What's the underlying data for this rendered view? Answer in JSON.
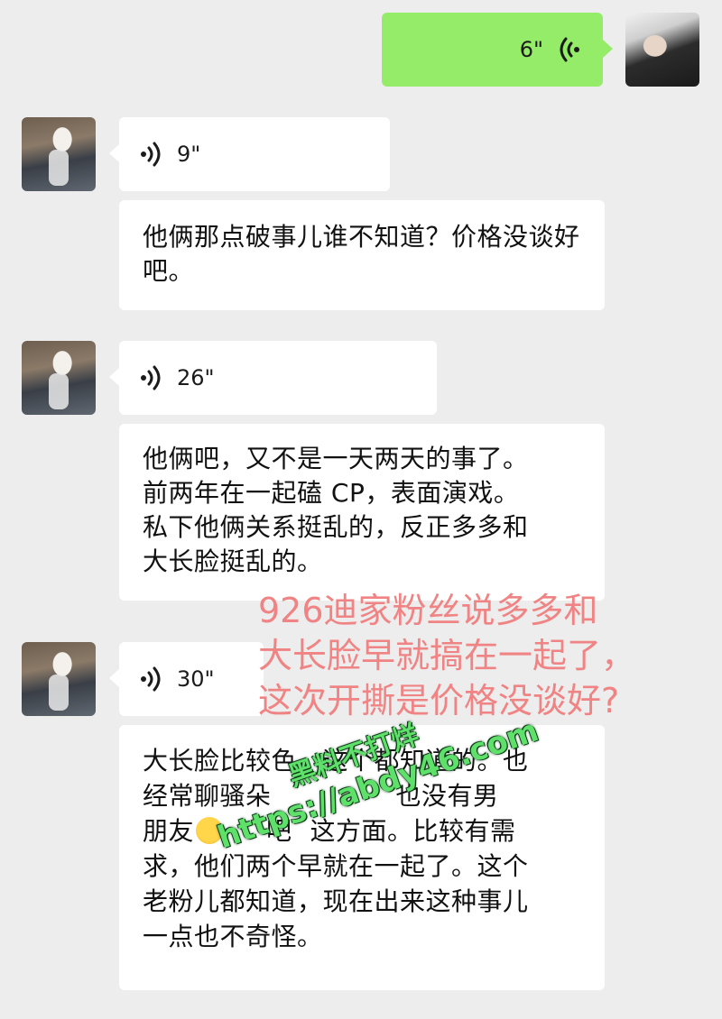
{
  "messages": [
    {
      "sender": "me",
      "type": "voice",
      "duration": "6\""
    },
    {
      "sender": "other",
      "type": "voice",
      "duration": "9\""
    },
    {
      "sender": "other",
      "type": "text",
      "text": "他俩那点破事儿谁不知道？价格没谈好吧。"
    },
    {
      "sender": "other",
      "type": "voice",
      "duration": "26\""
    },
    {
      "sender": "other",
      "type": "text",
      "lines": [
        "他俩吧，又不是一天两天的事了。",
        "前两年在一起磕 CP，表面演戏。",
        "私下他俩关系挺乱的，反正多多和",
        "大长脸挺乱的。"
      ]
    },
    {
      "sender": "other",
      "type": "voice",
      "duration": "30\""
    },
    {
      "sender": "other",
      "type": "text",
      "lines": [
        "大长脸比较色，这个都知道的。也",
        "经常聊骚朵",
        "也没有男",
        "朋友",
        "吧",
        "这方面。比较有需",
        "求，他们两个早就在一起了。这个",
        "老粉儿都知道，现在出来这种事儿",
        "一点也不奇怪。"
      ]
    }
  ],
  "overlay_caption": {
    "lines": [
      "926迪家粉丝说多多和",
      "大长脸早就搞在一起了，",
      "这次开撕是价格没谈好?"
    ],
    "color": "#f08383"
  },
  "watermark": {
    "line1": "黑料不打烊",
    "line2": "https://abdy46.com",
    "color": "#5fe06a"
  },
  "colors": {
    "background": "#ededed",
    "sent_bubble": "#95ec69",
    "received_bubble": "#ffffff"
  },
  "icons": [
    "voice-wave-icon",
    "emoji-icon"
  ]
}
